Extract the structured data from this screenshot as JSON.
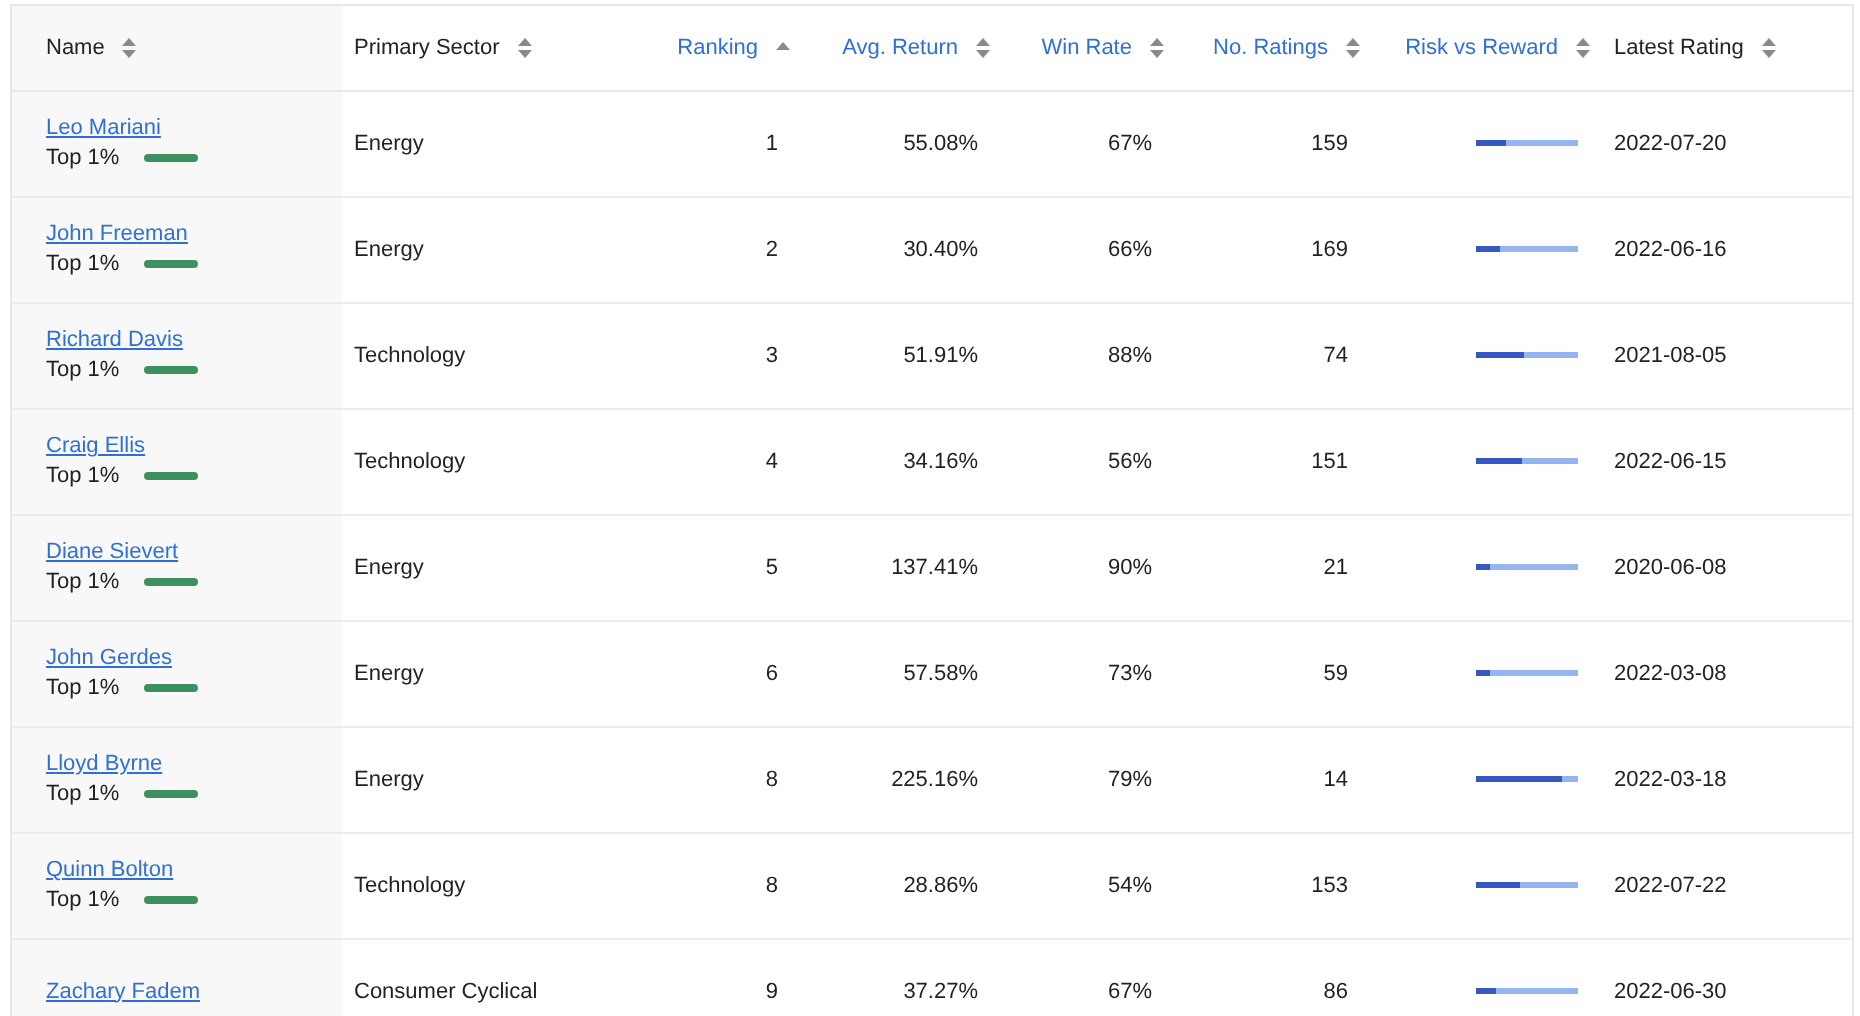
{
  "table": {
    "columns": [
      {
        "label": "Name",
        "highlighted": false,
        "sorted": false
      },
      {
        "label": "Primary Sector",
        "highlighted": false,
        "sorted": false
      },
      {
        "label": "Ranking",
        "highlighted": true,
        "sorted": true
      },
      {
        "label": "Avg. Return",
        "highlighted": true,
        "sorted": false
      },
      {
        "label": "Win Rate",
        "highlighted": true,
        "sorted": false
      },
      {
        "label": "No. Ratings",
        "highlighted": true,
        "sorted": false
      },
      {
        "label": "Risk vs Reward",
        "highlighted": true,
        "sorted": false
      },
      {
        "label": "Latest Rating",
        "highlighted": false,
        "sorted": false
      }
    ],
    "rows": [
      {
        "name": "Leo Mariani",
        "tier": "Top 1%",
        "sector": "Energy",
        "ranking": "1",
        "avg_return": "55.08%",
        "win_rate": "67%",
        "ratings": "159",
        "risk": {
          "level": 0.3
        },
        "latest": "2022-07-20"
      },
      {
        "name": "John Freeman",
        "tier": "Top 1%",
        "sector": "Energy",
        "ranking": "2",
        "avg_return": "30.40%",
        "win_rate": "66%",
        "ratings": "169",
        "risk": {
          "level": 0.24
        },
        "latest": "2022-06-16"
      },
      {
        "name": "Richard Davis",
        "tier": "Top 1%",
        "sector": "Technology",
        "ranking": "3",
        "avg_return": "51.91%",
        "win_rate": "88%",
        "ratings": "74",
        "risk": {
          "level": 0.47
        },
        "latest": "2021-08-05"
      },
      {
        "name": "Craig Ellis",
        "tier": "Top 1%",
        "sector": "Technology",
        "ranking": "4",
        "avg_return": "34.16%",
        "win_rate": "56%",
        "ratings": "151",
        "risk": {
          "level": 0.46
        },
        "latest": "2022-06-15"
      },
      {
        "name": "Diane Sievert",
        "tier": "Top 1%",
        "sector": "Energy",
        "ranking": "5",
        "avg_return": "137.41%",
        "win_rate": "90%",
        "ratings": "21",
        "risk": {
          "level": 0.13
        },
        "latest": "2020-06-08"
      },
      {
        "name": "John Gerdes",
        "tier": "Top 1%",
        "sector": "Energy",
        "ranking": "6",
        "avg_return": "57.58%",
        "win_rate": "73%",
        "ratings": "59",
        "risk": {
          "level": 0.13
        },
        "latest": "2022-03-08"
      },
      {
        "name": "Lloyd Byrne",
        "tier": "Top 1%",
        "sector": "Energy",
        "ranking": "8",
        "avg_return": "225.16%",
        "win_rate": "79%",
        "ratings": "14",
        "risk": {
          "level": 0.84
        },
        "latest": "2022-03-18"
      },
      {
        "name": "Quinn Bolton",
        "tier": "Top 1%",
        "sector": "Technology",
        "ranking": "8",
        "avg_return": "28.86%",
        "win_rate": "54%",
        "ratings": "153",
        "risk": {
          "level": 0.43
        },
        "latest": "2022-07-22"
      },
      {
        "name": "Zachary Fadem",
        "sector": "Consumer Cyclical",
        "ranking": "9",
        "avg_return": "37.27%",
        "win_rate": "67%",
        "ratings": "86",
        "risk": {
          "level": 0.19
        },
        "latest": "2022-06-30"
      }
    ]
  }
}
